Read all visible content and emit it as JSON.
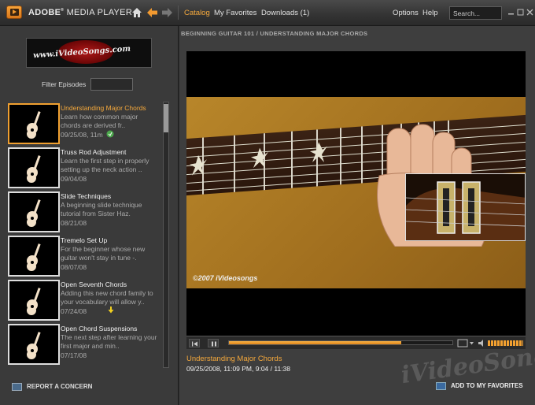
{
  "app": {
    "title_a": "ADOBE",
    "title_b": "MEDIA PLAYER"
  },
  "nav": {
    "catalog": "Catalog",
    "favorites": "My Favorites",
    "downloads": "Downloads (1)",
    "options": "Options",
    "help": "Help"
  },
  "search": {
    "placeholder": "Search..."
  },
  "left": {
    "banner_text": "www.iVideoSongs.com",
    "filter_label": "Filter Episodes",
    "episodes": [
      {
        "title": "Understanding Major Chords",
        "desc": "Learn how common major chords are derived fr..",
        "date": "09/25/08, 11m"
      },
      {
        "title": "Truss Rod Adjustment",
        "desc": "Learn the first step in properly setting up the neck action ..",
        "date": "09/04/08"
      },
      {
        "title": "Slide Techniques",
        "desc": "A beginning slide technique tutorial from Sister Haz.",
        "date": "08/21/08"
      },
      {
        "title": "Tremelo Set Up",
        "desc": "For the beginner whose new guitar won't stay in tune -.",
        "date": "08/07/08"
      },
      {
        "title": "Open Seventh Chords",
        "desc": "Adding this new chord family to your vocabulary will allow y..",
        "date": "07/24/08"
      },
      {
        "title": "Open Chord Suspensions",
        "desc": "The next step after learning your first major and min..",
        "date": "07/17/08"
      }
    ],
    "report": "REPORT A CONCERN"
  },
  "right": {
    "breadcrumb": "BEGINNING GUITAR 101   /   UNDERSTANDING MAJOR CHORDS",
    "copyright": "©2007 iVideosongs",
    "progress": 0.77,
    "now_title": "Understanding Major Chords",
    "now_meta": "09/25/2008, 11:09 PM,  9:04 / 11:38",
    "watermark": "iVideoSongs",
    "add_fav": "ADD TO MY FAVORITES"
  },
  "colors": {
    "accent": "#f4a83c",
    "background": "#3a3a3a"
  }
}
